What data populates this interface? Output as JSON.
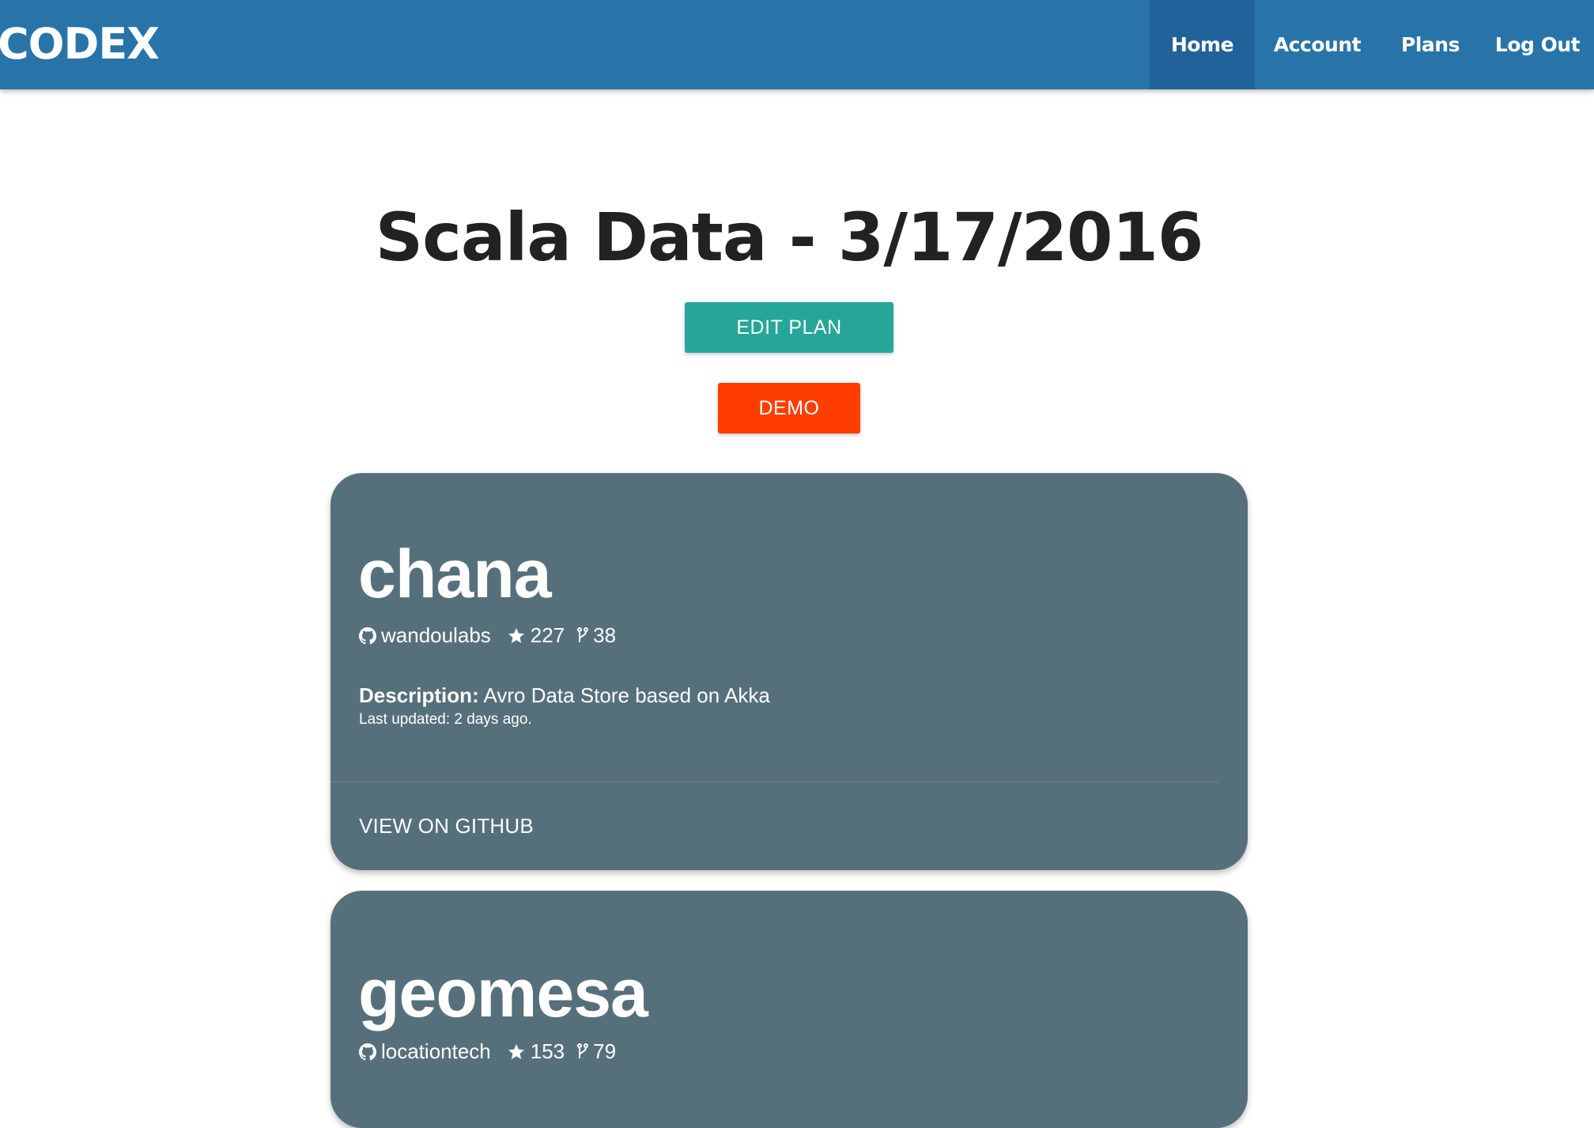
{
  "brand": "CODEX",
  "nav": {
    "home": "Home",
    "account": "Account",
    "plans": "Plans",
    "logout": "Log Out",
    "active": "Home"
  },
  "page": {
    "title": "Scala Data - 3/17/2016",
    "edit_button": "EDIT PLAN",
    "demo_button": "DEMO"
  },
  "colors": {
    "navbar": "#2874a9",
    "edit_button": "#26a69a",
    "demo_button": "#ff3d00",
    "card": "#56707b"
  },
  "repos": [
    {
      "name": "chana",
      "owner": "wandoulabs",
      "stars": "227",
      "forks": "38",
      "description_label": "Description:",
      "description": "Avro Data Store based on Akka",
      "last_updated": "Last updated: 2 days ago.",
      "action": "VIEW ON GITHUB",
      "icons": [
        "github-icon",
        "star-icon",
        "fork-icon"
      ]
    },
    {
      "name": "geomesa",
      "owner": "locationtech",
      "stars": "153",
      "forks": "79",
      "icons": [
        "github-icon",
        "star-icon",
        "fork-icon"
      ]
    }
  ]
}
